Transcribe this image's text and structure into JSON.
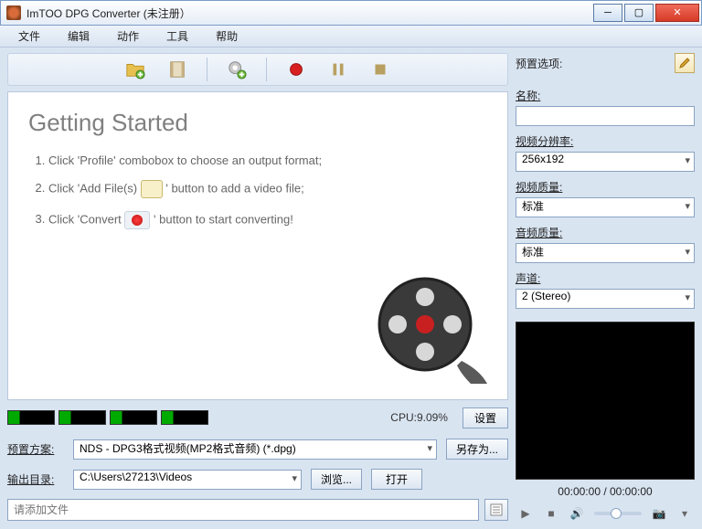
{
  "window": {
    "title": "ImTOO DPG Converter (未注册）"
  },
  "win_controls": {
    "min": "─",
    "max": "▢",
    "close": "✕"
  },
  "menu": [
    "文件",
    "编辑",
    "动作",
    "工具",
    "帮助"
  ],
  "getting_started": {
    "title": "Getting Started",
    "step1a": "Click 'Profile' combobox to choose an output format;",
    "step2a": "Click 'Add File(s)",
    "step2b": "' button to add a video file;",
    "step3a": "Click 'Convert",
    "step3b": "' button to start converting!"
  },
  "cpu": {
    "label": "CPU:9.09%",
    "settings": "设置"
  },
  "profile": {
    "label": "预置方案:",
    "value": "NDS - DPG3格式视频(MP2格式音频) (*.dpg)",
    "save_as": "另存为..."
  },
  "output": {
    "label": "输出目录:",
    "value": "C:\\Users\\27213\\Videos",
    "browse": "浏览...",
    "open": "打开"
  },
  "bottom_input": {
    "placeholder": "请添加文件"
  },
  "preset": {
    "header": "预置选项:",
    "name_label": "名称:",
    "name_value": "",
    "res_label": "视频分辨率:",
    "res_value": "256x192",
    "vq_label": "视频质量:",
    "vq_value": "标准",
    "aq_label": "音频质量:",
    "aq_value": "标准",
    "ch_label": "声道:",
    "ch_value": "2 (Stereo)"
  },
  "time": "00:00:00 / 00:00:00"
}
